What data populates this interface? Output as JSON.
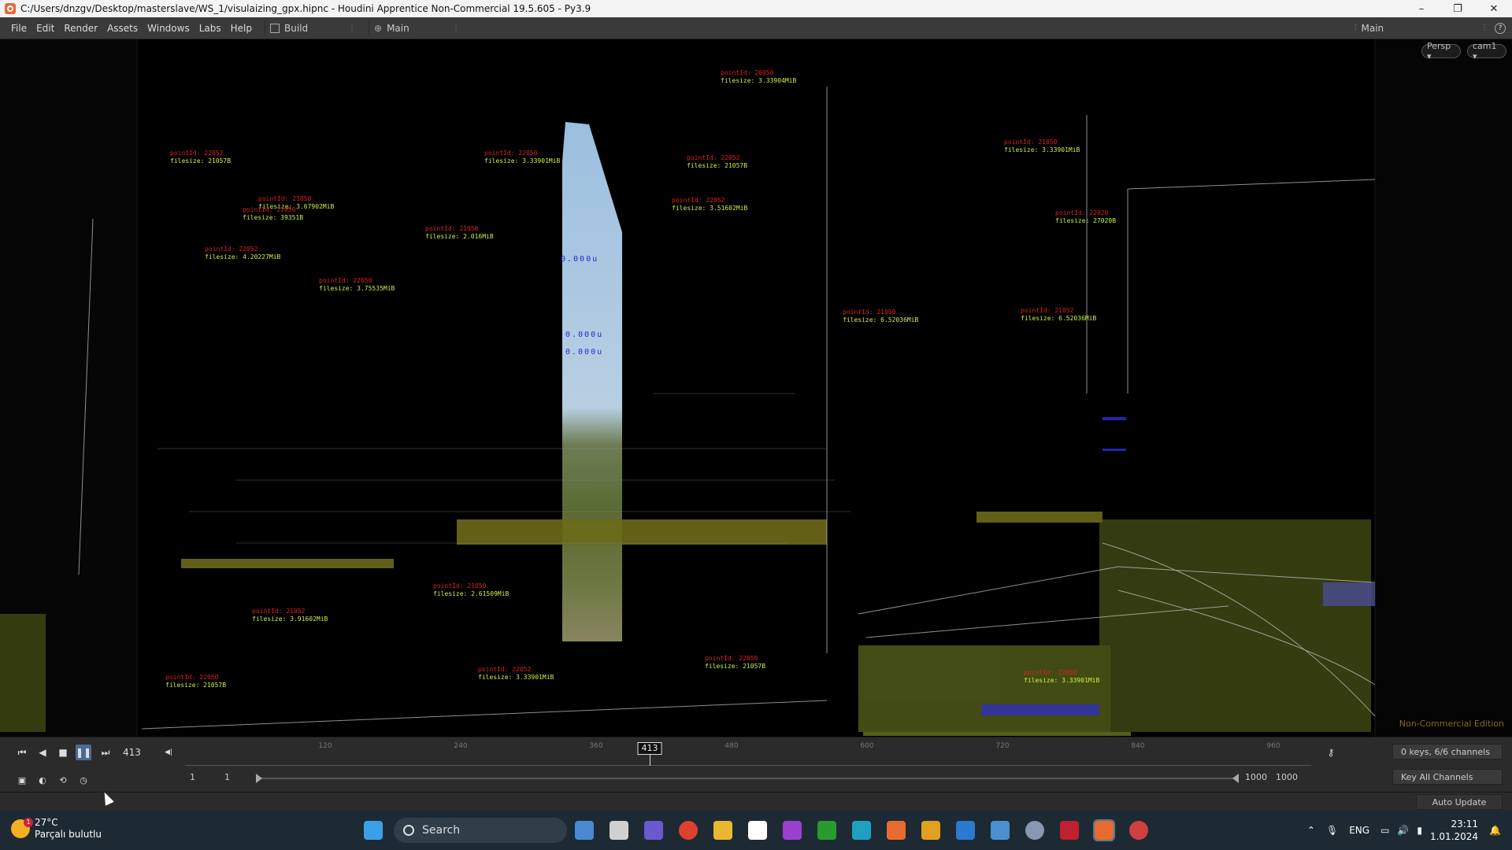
{
  "window": {
    "title": "C:/Users/dnzgv/Desktop/masterslave/WS_1/visulaizing_gpx.hipnc - Houdini Apprentice Non-Commercial 19.5.605 - Py3.9",
    "controls": [
      "–",
      "❐",
      "✕"
    ]
  },
  "menubar": {
    "items": [
      "File",
      "Edit",
      "Render",
      "Assets",
      "Windows",
      "Labs",
      "Help"
    ],
    "desktop_build": "Build",
    "desktop_main": "Main",
    "right_desktop": "Main"
  },
  "viewport": {
    "persp_button": "Persp ▾",
    "cam_button": "cam1 ▾",
    "watermark": "Non-Commercial Edition",
    "labels": [
      {
        "red": "pointId: 20050",
        "green": "filesize: 3.33904MiB"
      },
      {
        "red": "pointId: 22052",
        "green": "filesize: 21057B"
      },
      {
        "red": "pointId: 22050",
        "green": "filesize: 3.33901MiB"
      },
      {
        "red": "pointId: 22052",
        "green": "filesize: 21057B"
      },
      {
        "red": "pointId: 21050",
        "green": "filesize: 3.33901MiB"
      },
      {
        "red": "pointId: 22052",
        "green": "filesize: 3.51602MiB"
      },
      {
        "red": "pointId: 22020",
        "green": "filesize: 27020B"
      },
      {
        "red": "pointId: 21050",
        "green": "filesize: 3.67902MiB"
      },
      {
        "red": "pointId: 21050",
        "green": "filesize: 39351B"
      },
      {
        "red": "pointId: 22052",
        "green": "filesize: 4.20227MiB"
      },
      {
        "red": "pointId: 22050",
        "green": "filesize: 3.75535MiB"
      },
      {
        "red": "pointId: 21050",
        "green": "filesize: 2.016MiB"
      },
      {
        "red": "pointId: 21052",
        "green": "filesize: 6.52036MiB"
      },
      {
        "red": "pointId: 21050",
        "green": "filesize: 6.52036MiB"
      },
      {
        "red": "pointId: 21050",
        "green": "filesize: 2.61509MiB"
      },
      {
        "red": "pointId: 21052",
        "green": "filesize: 3.91602MiB"
      },
      {
        "red": "pointId: 22050",
        "green": "filesize: 21057B"
      },
      {
        "red": "pointId: 22052",
        "green": "filesize: 3.33901MiB"
      },
      {
        "red": "pointId: 22050",
        "green": "filesize: 21057B"
      },
      {
        "red": "pointId: 22050",
        "green": "filesize: 3.33901MiB"
      }
    ],
    "blue_text": [
      "0.000u",
      "0.000u",
      "0.000u"
    ]
  },
  "timeline": {
    "current_frame": "413",
    "ruler_ticks": [
      "120",
      "240",
      "360",
      "480",
      "600",
      "720",
      "840",
      "960"
    ],
    "cursor_label": "413",
    "range_start_1": "1",
    "range_start_2": "1",
    "range_end_1": "1000",
    "range_end_2": "1000",
    "keys_channels": "0 keys, 6/6 channels",
    "key_all_channels": "Key All Channels",
    "auto_update": "Auto Update"
  },
  "taskbar": {
    "temperature": "27°C",
    "weather": "Parçalı bulutlu",
    "weather_badge": "1",
    "search_label": "Search",
    "language": "ENG",
    "time": "23:11",
    "date": "1.01.2024"
  }
}
